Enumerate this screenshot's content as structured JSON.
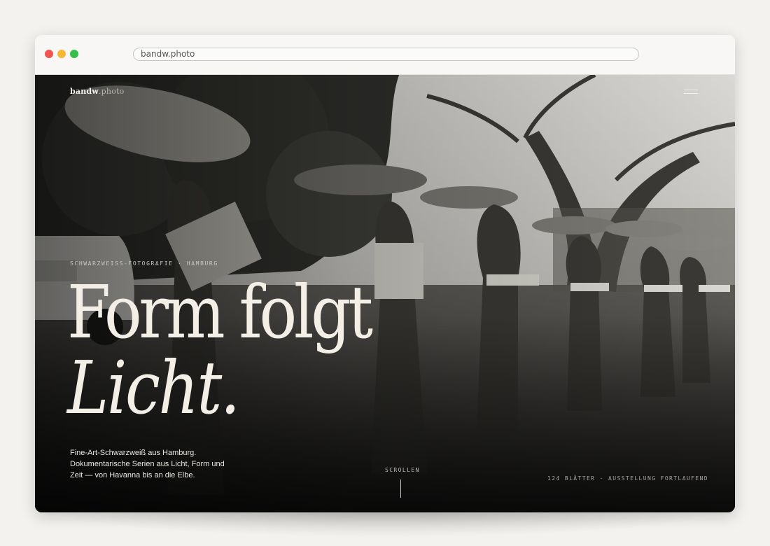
{
  "browser": {
    "url": "bandw.photo"
  },
  "site": {
    "logo_name": "bandw",
    "logo_tld": ".photo",
    "menu_icon": "hamburger-menu-icon"
  },
  "hero": {
    "eyebrow": "SCHWARZWEISS-FOTOGRAFIE · HAMBURG",
    "headline_line1": "Form folgt",
    "headline_line2": "Licht.",
    "lede": "Fine-Art-Schwarzweiß aus Hamburg. Dokumentarische Serien aus Licht, Form und Zeit — von Havanna bis an die Elbe.",
    "scroll_label": "SCROLLEN",
    "meta": "124 BLÄTTER · AUSSTELLUNG FORTLAUFEND"
  },
  "colors": {
    "window_controls": [
      "#f0564f",
      "#f7b631",
      "#33c046"
    ],
    "headline": "#f3efe7",
    "photo_tone": "#2e2d2b"
  }
}
